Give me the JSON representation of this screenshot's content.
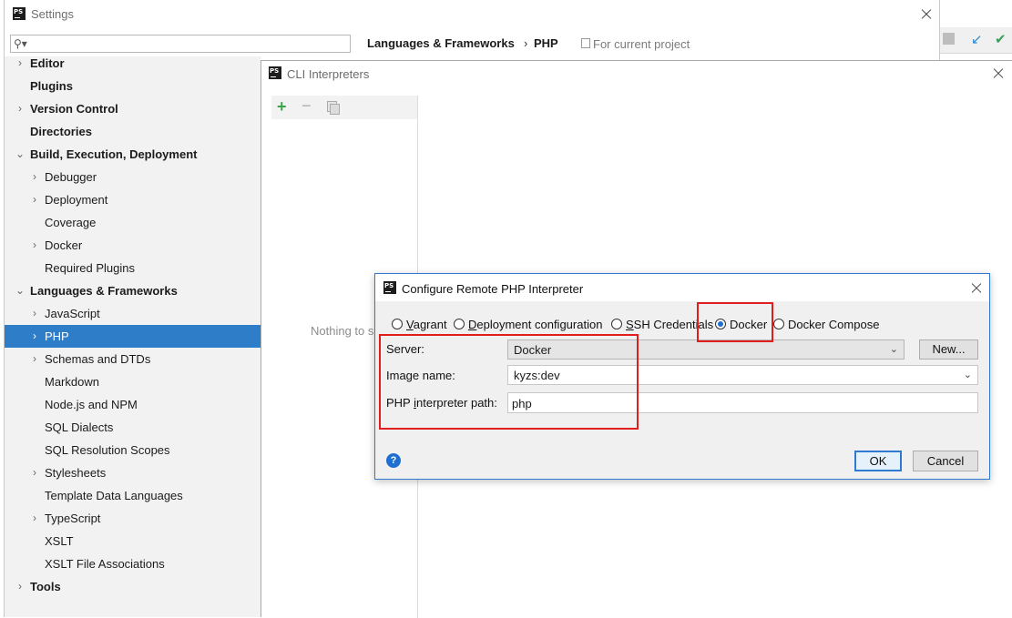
{
  "settings": {
    "title": "Settings",
    "search": {
      "placeholder": "",
      "icon": "search-icon"
    },
    "breadcrumb": {
      "section": "Languages & Frameworks",
      "separator": "›",
      "page": "PHP",
      "scope": "For current project"
    },
    "sidebar": {
      "items": [
        {
          "label": "Editor",
          "expandable": true,
          "level": 0
        },
        {
          "label": "Plugins",
          "expandable": false,
          "level": 0
        },
        {
          "label": "Version Control",
          "expandable": true,
          "level": 0
        },
        {
          "label": "Directories",
          "expandable": false,
          "level": 0
        },
        {
          "label": "Build, Execution, Deployment",
          "expandable": true,
          "expanded": true,
          "level": 0
        },
        {
          "label": "Debugger",
          "expandable": true,
          "level": 1
        },
        {
          "label": "Deployment",
          "expandable": true,
          "level": 1
        },
        {
          "label": "Coverage",
          "expandable": false,
          "level": 1
        },
        {
          "label": "Docker",
          "expandable": true,
          "level": 1
        },
        {
          "label": "Required Plugins",
          "expandable": false,
          "level": 1
        },
        {
          "label": "Languages & Frameworks",
          "expandable": true,
          "expanded": true,
          "level": 0
        },
        {
          "label": "JavaScript",
          "expandable": true,
          "level": 1
        },
        {
          "label": "PHP",
          "expandable": true,
          "level": 1,
          "selected": true
        },
        {
          "label": "Schemas and DTDs",
          "expandable": true,
          "level": 1
        },
        {
          "label": "Markdown",
          "expandable": false,
          "level": 1
        },
        {
          "label": "Node.js and NPM",
          "expandable": false,
          "level": 1
        },
        {
          "label": "SQL Dialects",
          "expandable": false,
          "level": 1
        },
        {
          "label": "SQL Resolution Scopes",
          "expandable": false,
          "level": 1
        },
        {
          "label": "Stylesheets",
          "expandable": true,
          "level": 1
        },
        {
          "label": "Template Data Languages",
          "expandable": false,
          "level": 1
        },
        {
          "label": "TypeScript",
          "expandable": true,
          "level": 1
        },
        {
          "label": "XSLT",
          "expandable": false,
          "level": 1
        },
        {
          "label": "XSLT File Associations",
          "expandable": false,
          "level": 1
        },
        {
          "label": "Tools",
          "expandable": true,
          "level": 0
        }
      ]
    }
  },
  "cli_dialog": {
    "title": "CLI Interpreters",
    "toolbar": {
      "add": "+",
      "remove": "−"
    },
    "empty_text": "Nothing to show"
  },
  "remote_dialog": {
    "title": "Configure Remote PHP Interpreter",
    "options": [
      {
        "mnemonic": "V",
        "rest": "agrant",
        "checked": false
      },
      {
        "mnemonic": "D",
        "rest": "eployment configuration",
        "checked": false
      },
      {
        "mnemonic": "S",
        "rest": "SH Credentials",
        "checked": false
      },
      {
        "mnemonic": "",
        "rest": "Docker",
        "checked": true
      },
      {
        "mnemonic": "",
        "rest": "Docker Compose",
        "checked": false
      }
    ],
    "server_label": "Server:",
    "server_value": "Docker",
    "new_button": "New...",
    "image_label": "Image name:",
    "image_value": "kyzs:dev",
    "php_path_label_pre": "PHP ",
    "php_path_label_mnemonic": "i",
    "php_path_label_post": "nterpreter path:",
    "php_path_value": "php",
    "help": "?",
    "ok": "OK",
    "cancel": "Cancel"
  },
  "colors": {
    "selection": "#2e7dc9",
    "annotation_red": "#e11d1d",
    "dialog_border": "#2f7ad1"
  }
}
